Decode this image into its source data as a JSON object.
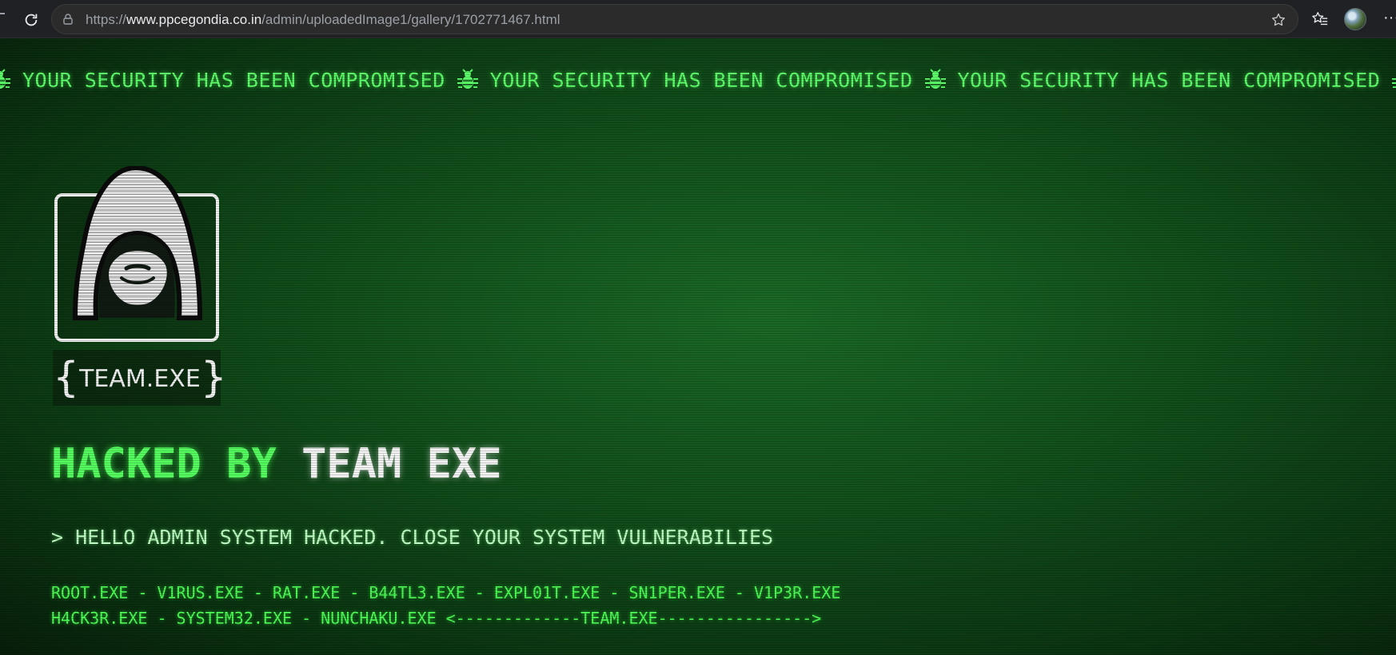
{
  "browser": {
    "url_prefix": "https://",
    "url_host": "www.ppcegondia.co.in",
    "url_path": "/admin/uploadedImage1/gallery/1702771467.html",
    "more_label": "···"
  },
  "ticker": {
    "text": "YOUR SECURITY HAS BEEN COMPROMISED"
  },
  "logo": {
    "caption": "TEAM.EXE",
    "brace_open": "{",
    "brace_close": "}"
  },
  "headline": {
    "part1": "HACKED BY",
    "part2": "TEAM EXE"
  },
  "message": "> HELLO ADMIN SYSTEM HACKED. CLOSE YOUR SYSTEM VULNERABILIES",
  "tags": {
    "line1": "ROOT.EXE - V1RUS.EXE - RAT.EXE - B44TL3.EXE - EXPL01T.EXE - SN1PER.EXE - V1P3R.EXE",
    "line2": "H4CK3R.EXE - SYSTEM32.EXE - NUNCHAKU.EXE <-------------TEAM.EXE---------------->"
  },
  "colors": {
    "terminal_green": "#56ff60",
    "background_green": "#13531d",
    "white": "#f4f4f4"
  }
}
